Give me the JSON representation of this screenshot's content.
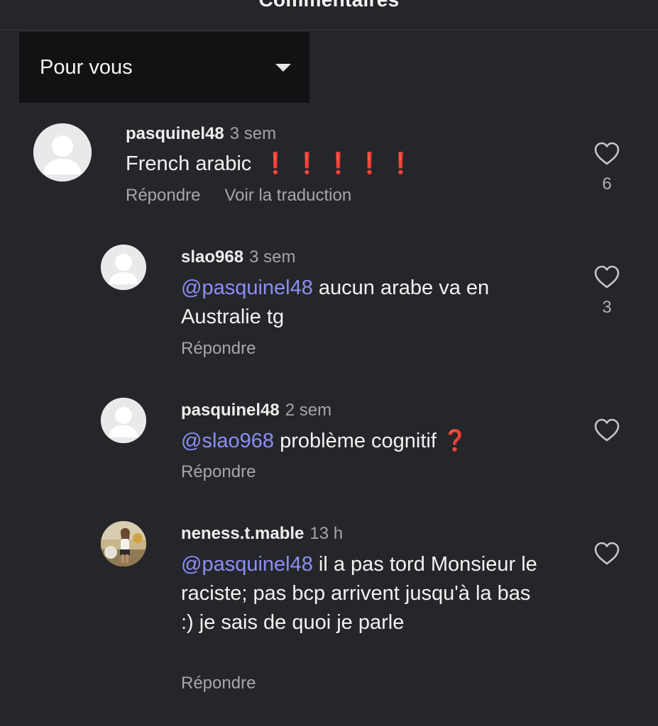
{
  "header": {
    "title": "Commentaires"
  },
  "sort": {
    "selected": "Pour vous"
  },
  "actions": {
    "reply": "Répondre",
    "translate": "Voir la traduction"
  },
  "icons": {
    "like": "heart-outline-icon",
    "dropdown": "triangle-down-icon",
    "avatar": "default-avatar-icon"
  },
  "colors": {
    "background": "#25262a",
    "mention": "#8c8ff5",
    "muted": "#a3a5aa"
  },
  "comments": [
    {
      "author": "pasquinel48",
      "time": "3 sem",
      "text": "French arabic",
      "emphasis": "❗❗❗❗❗",
      "likes": "6"
    },
    {
      "author": "slao968",
      "time": "3 sem",
      "mention": "@pasquinel48",
      "text": "aucun arabe va en Australie tg",
      "likes": "3"
    },
    {
      "author": "pasquinel48",
      "time": "2 sem",
      "mention": "@slao968",
      "text": "problème cognitif",
      "emoji": "❓",
      "likes": ""
    },
    {
      "author": "neness.t.mable",
      "time": "13 h",
      "mention": "@pasquinel48",
      "text": "il a pas tord Monsieur le raciste; pas bcp arrivent jusqu'à la bas :) je sais de quoi je parle",
      "likes": ""
    }
  ]
}
